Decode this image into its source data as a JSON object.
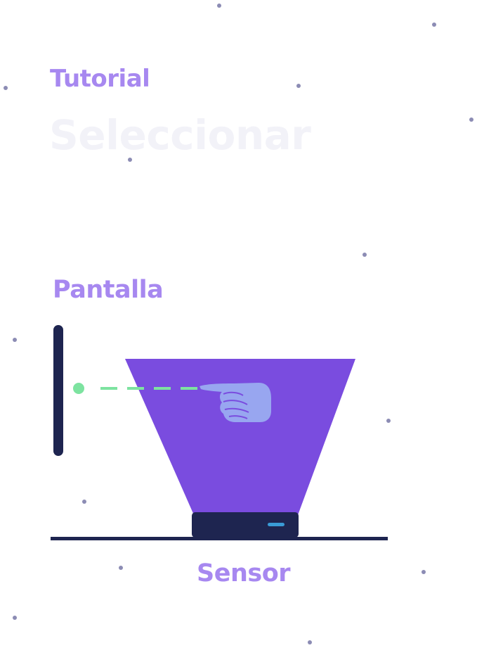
{
  "header": {
    "eyebrow": "Tutorial",
    "title": "Seleccionar"
  },
  "illustration": {
    "screen_label": "Pantalla",
    "sensor_label": "Sensor"
  },
  "colors": {
    "accent": "#a788f0",
    "beam": "#7a4cdf",
    "hand": "#98a6f0",
    "device": "#1e2550",
    "pointer_line": "#7de3a0",
    "sensor_led": "#3a9bd6",
    "title_faded": "#f2f2f8",
    "star": "#8c8cb4"
  },
  "icons": {
    "hand": "pointing-hand-icon",
    "screen": "screen-bar-icon",
    "sensor": "sensor-device-icon"
  }
}
